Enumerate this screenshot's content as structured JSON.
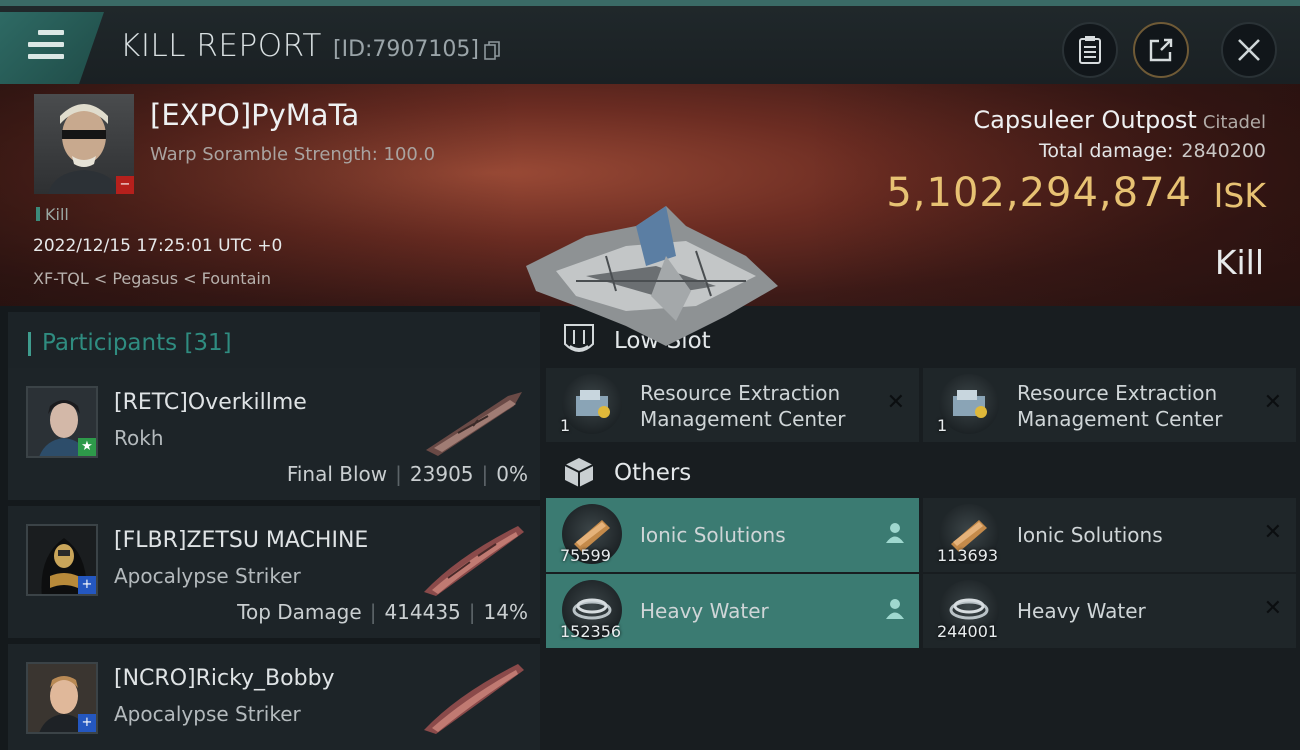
{
  "topbar": {
    "title": "KILL REPORT",
    "report_id": "[ID:7907105]"
  },
  "victim": {
    "name": "[EXPO]PyMaTa",
    "subtitle": "Warp Soramble Strength: 100.0",
    "tag": "Kill",
    "datetime": "2022/12/15 17:25:01 UTC +0",
    "location": "XF-TQL < Pegasus < Fountain"
  },
  "target": {
    "name": "Capsuleer Outpost",
    "class": "Citadel",
    "total_damage_label": "Total damage:",
    "total_damage_value": "2840200",
    "isk_value": "5,102,294,874",
    "isk_unit": "ISK",
    "result": "Kill"
  },
  "participants": {
    "label": "Participants",
    "count": "[31]",
    "rows": [
      {
        "name": "[RETC]Overkillme",
        "ship": "Rokh",
        "role": "Final Blow",
        "damage": "23905",
        "percent": "0%"
      },
      {
        "name": "[FLBR]ZETSU MACHINE",
        "ship": "Apocalypse Striker",
        "role": "Top Damage",
        "damage": "414435",
        "percent": "14%"
      },
      {
        "name": "[NCRO]Ricky_Bobby",
        "ship": "Apocalypse Striker"
      }
    ]
  },
  "low_slot": {
    "label": "Low Slot",
    "items": [
      {
        "name": "Resource Extraction Management Center",
        "qty": "1"
      },
      {
        "name": "Resource Extraction Management Center",
        "qty": "1"
      }
    ]
  },
  "others": {
    "label": "Others",
    "items": [
      {
        "name": "Ionic Solutions",
        "qty": "75599"
      },
      {
        "name": "Ionic Solutions",
        "qty": "113693"
      },
      {
        "name": "Heavy Water",
        "qty": "152356"
      },
      {
        "name": "Heavy Water",
        "qty": "244001"
      }
    ]
  },
  "colors": {
    "accent_teal": "#3b7b72",
    "isk_gold": "#e7c273"
  }
}
